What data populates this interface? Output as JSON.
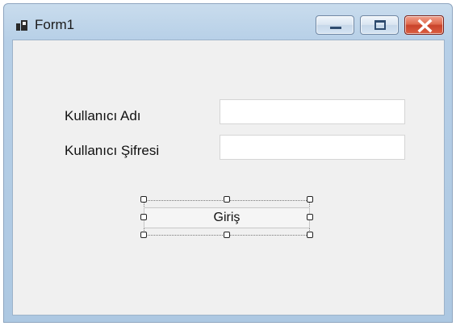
{
  "window": {
    "title": "Form1",
    "icons": {
      "app": "form-icon",
      "minimize": "minimize-icon",
      "maximize": "maximize-icon",
      "close": "close-icon"
    },
    "colors": {
      "frame": "#b6cfe7",
      "client": "#f0f0f0",
      "close_button": "#d85a3d"
    }
  },
  "form": {
    "username_label": "Kullanıcı Adı",
    "password_label": "Kullanıcı Şifresi",
    "username_value": "",
    "password_value": "",
    "login_button": "Giriş"
  }
}
